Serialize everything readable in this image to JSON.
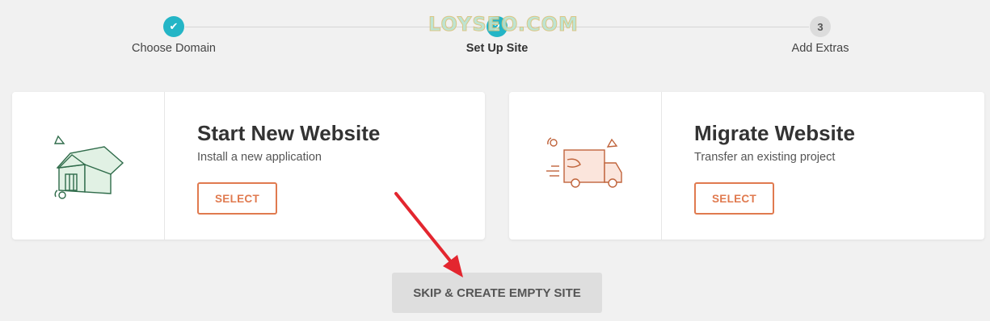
{
  "stepper": {
    "steps": [
      {
        "label": "Choose Domain",
        "state": "done",
        "marker": "✔"
      },
      {
        "label": "Set Up Site",
        "state": "active",
        "marker": "2"
      },
      {
        "label": "Add Extras",
        "state": "todo",
        "marker": "3"
      }
    ],
    "accent_color": "#24b5c6"
  },
  "watermark": "LOYSEO.COM",
  "cards": [
    {
      "title": "Start New Website",
      "description": "Install a new application",
      "button_label": "SELECT",
      "illustration": "house-icon"
    },
    {
      "title": "Migrate Website",
      "description": "Transfer an existing project",
      "button_label": "SELECT",
      "illustration": "moving-truck-icon"
    }
  ],
  "skip_button_label": "SKIP & CREATE EMPTY SITE",
  "colors": {
    "button_accent": "#e07a4f",
    "annotation_arrow": "#e3262f"
  }
}
